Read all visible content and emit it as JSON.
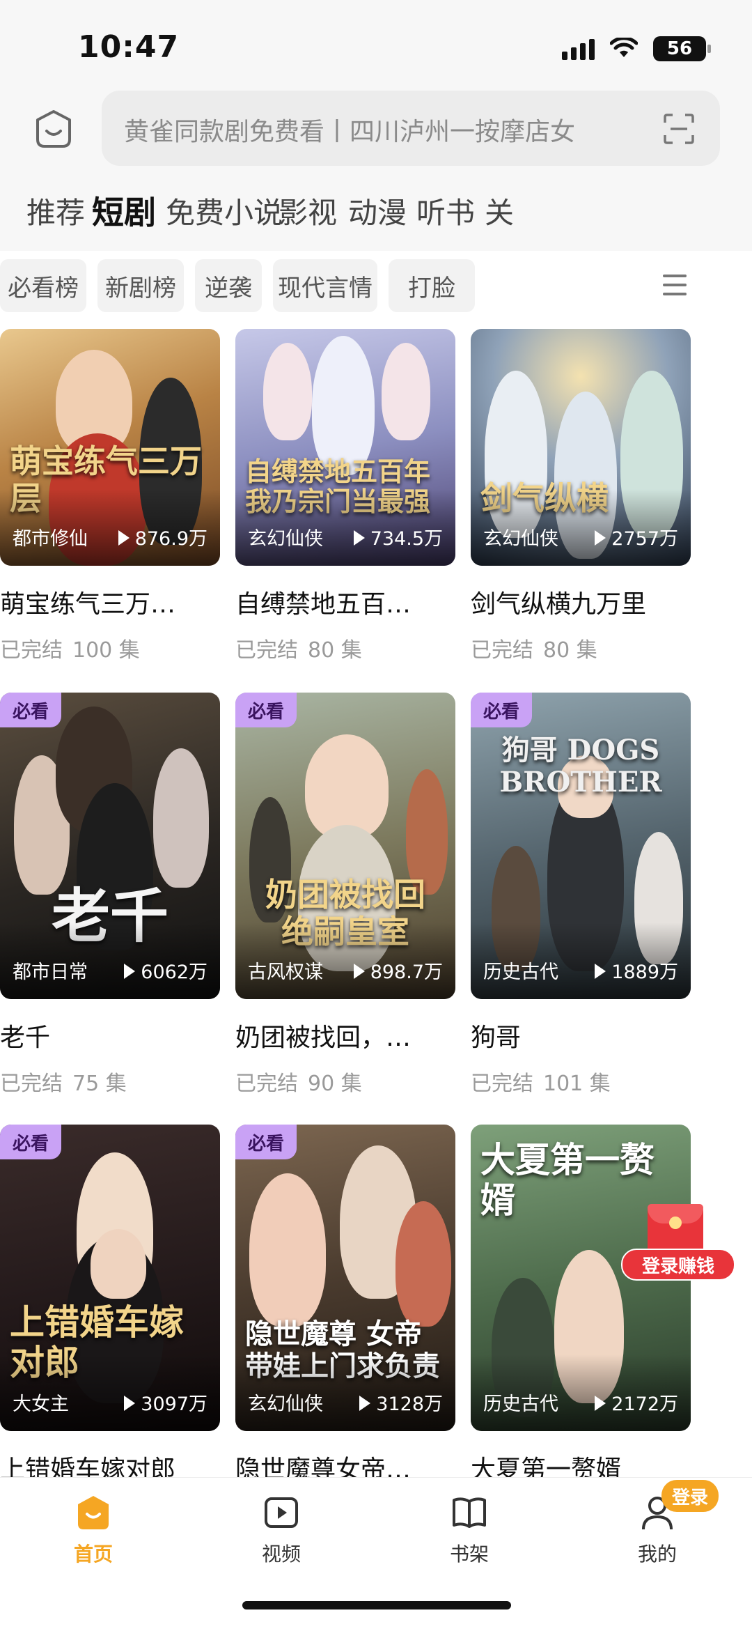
{
  "status_bar": {
    "time": "10:47",
    "battery": "56"
  },
  "search": {
    "placeholder": "黄雀同款剧免费看丨四川泸州一按摩店女"
  },
  "tabs": [
    "推荐",
    "短剧",
    "免费小说",
    "影视",
    "动漫",
    "听书",
    "关"
  ],
  "active_tab": "短剧",
  "chips": [
    "必看榜",
    "新剧榜",
    "逆袭",
    "现代言情",
    "打脸"
  ],
  "badge_label": "必看",
  "dramas": [
    {
      "title": "萌宝练气三万…",
      "poster_text": "萌宝练气三万层",
      "genre": "都市修仙",
      "views": "876.9万",
      "status": "已完结",
      "episodes": "100 集",
      "badge": false
    },
    {
      "title": "自缚禁地五百…",
      "poster_text": "自缚禁地五百年 我乃宗门当最强",
      "genre": "玄幻仙侠",
      "views": "734.5万",
      "status": "已完结",
      "episodes": "80 集",
      "badge": false
    },
    {
      "title": "剑气纵横九万里",
      "poster_text": "剑气纵横",
      "genre": "玄幻仙侠",
      "views": "2757万",
      "status": "已完结",
      "episodes": "80 集",
      "badge": false
    },
    {
      "title": "老千",
      "poster_text": "老千",
      "genre": "都市日常",
      "views": "6062万",
      "status": "已完结",
      "episodes": "75 集",
      "badge": true
    },
    {
      "title": "奶团被找回，…",
      "poster_text": "奶团被找回 绝嗣皇室",
      "genre": "古风权谋",
      "views": "898.7万",
      "status": "已完结",
      "episodes": "90 集",
      "badge": true
    },
    {
      "title": "狗哥",
      "poster_text": "狗哥 DOGS BROTHER",
      "genre": "历史古代",
      "views": "1889万",
      "status": "已完结",
      "episodes": "101 集",
      "badge": true
    },
    {
      "title": "上错婚车嫁对郎",
      "poster_text": "上错婚车嫁对郎",
      "genre": "大女主",
      "views": "3097万",
      "status": "",
      "episodes": "",
      "badge": true
    },
    {
      "title": "隐世魔尊女帝…",
      "poster_text": "隐世魔尊 女帝带娃上门求负责",
      "genre": "玄幻仙侠",
      "views": "3128万",
      "status": "",
      "episodes": "",
      "badge": true
    },
    {
      "title": "大夏第一赘婿",
      "poster_text": "大夏第一赘婿",
      "genre": "历史古代",
      "views": "2172万",
      "status": "",
      "episodes": "",
      "badge": false
    }
  ],
  "promo": {
    "label": "登录赚钱"
  },
  "bottom_nav": {
    "items": [
      {
        "label": "首页",
        "icon": "home-icon"
      },
      {
        "label": "视频",
        "icon": "video-play-icon"
      },
      {
        "label": "书架",
        "icon": "book-icon"
      },
      {
        "label": "我的",
        "icon": "user-icon"
      }
    ],
    "login_badge": "登录"
  },
  "colors": {
    "accent": "#f5a623",
    "badge_bg": "#c9a2f5",
    "promo_red": "#e8343a"
  }
}
